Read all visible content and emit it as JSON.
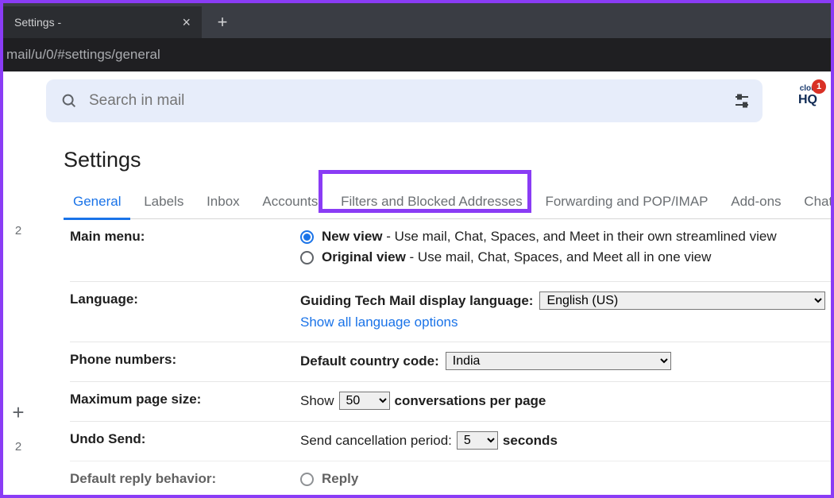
{
  "browser": {
    "tab_title": "Settings -",
    "address": "mail/u/0/#settings/general"
  },
  "search": {
    "placeholder": "Search in mail"
  },
  "hq": {
    "top": "clou",
    "bottom": "HQ",
    "badge": "1"
  },
  "page_title": "Settings",
  "tabs": {
    "general": "General",
    "labels": "Labels",
    "inbox": "Inbox",
    "accounts": "Accounts",
    "filters": "Filters and Blocked Addresses",
    "forwarding": "Forwarding and POP/IMAP",
    "addons": "Add-ons",
    "chat": "Chat"
  },
  "gutter": {
    "n1": "2",
    "n2": "2"
  },
  "rows": {
    "main_menu": {
      "label": "Main menu:",
      "opt1_name": "New view",
      "opt1_desc": " - Use mail, Chat, Spaces, and Meet in their own streamlined view",
      "opt2_name": "Original view",
      "opt2_desc": " - Use mail, Chat, Spaces, and Meet all in one view"
    },
    "language": {
      "label": "Language:",
      "display_lang_label": "Guiding Tech Mail display language:",
      "value": "English (US)",
      "show_all": "Show all language options"
    },
    "phone": {
      "label": "Phone numbers:",
      "code_label": "Default country code:",
      "value": "India"
    },
    "page_size": {
      "label": "Maximum page size:",
      "prefix": "Show",
      "value": "50",
      "suffix": "conversations per page"
    },
    "undo_send": {
      "label": "Undo Send:",
      "prefix": "Send cancellation period:",
      "value": "5",
      "suffix": "seconds"
    },
    "reply_behavior": {
      "label": "Default reply behavior:",
      "option": "Reply"
    }
  }
}
